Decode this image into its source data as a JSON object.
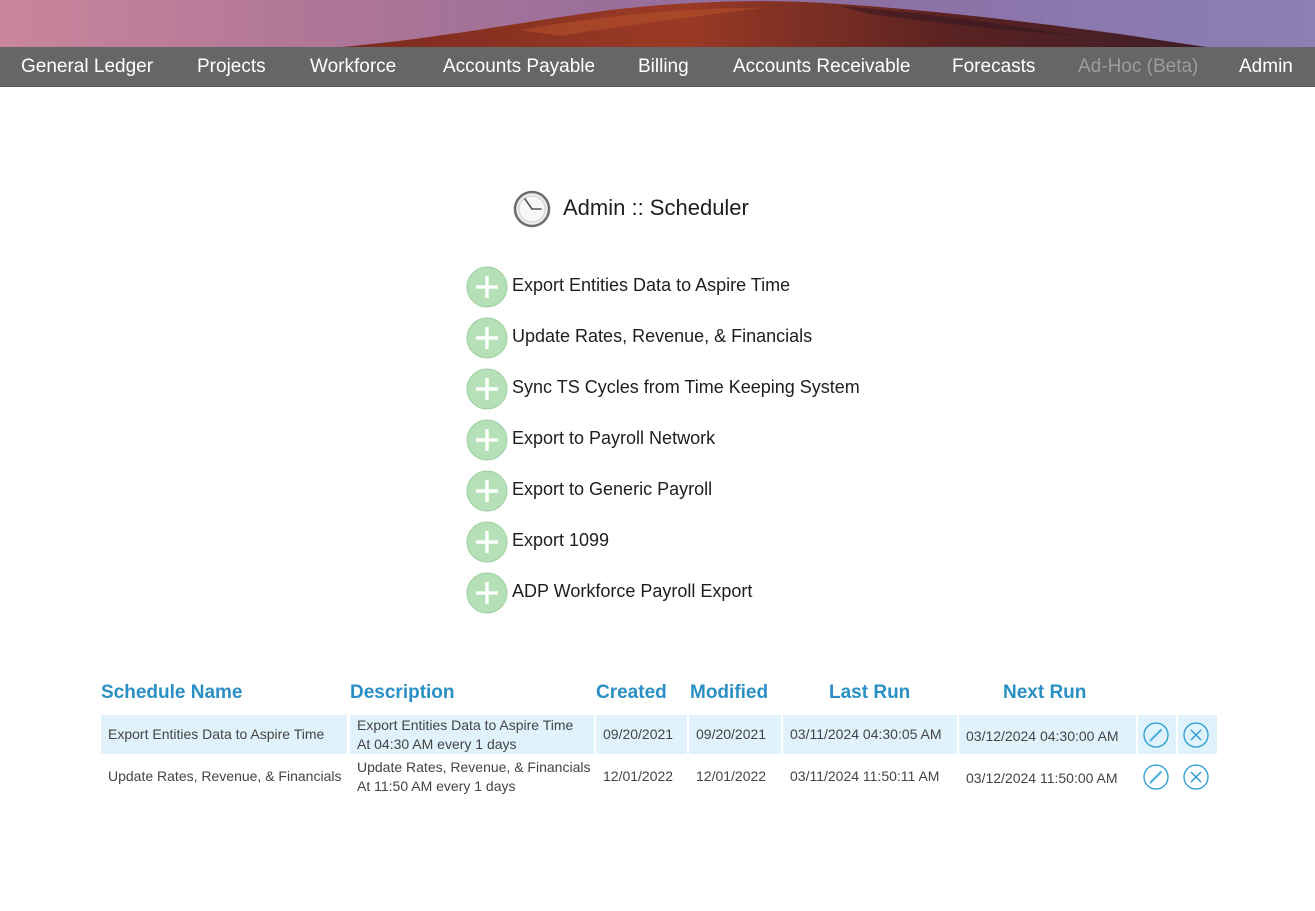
{
  "nav": {
    "items": [
      {
        "label": "General Ledger"
      },
      {
        "label": "Projects"
      },
      {
        "label": "Workforce"
      },
      {
        "label": "Accounts Payable"
      },
      {
        "label": "Billing"
      },
      {
        "label": "Accounts Receivable"
      },
      {
        "label": "Forecasts"
      },
      {
        "label": "Ad-Hoc (Beta)",
        "disabled": true
      },
      {
        "label": "Admin"
      }
    ]
  },
  "page": {
    "title": "Admin :: Scheduler",
    "title_icon": "clock-icon"
  },
  "tasks": [
    {
      "label": "Export Entities Data to Aspire Time",
      "icon": "add-icon"
    },
    {
      "label": "Update Rates, Revenue, & Financials",
      "icon": "add-icon"
    },
    {
      "label": "Sync TS Cycles from Time Keeping System",
      "icon": "add-icon"
    },
    {
      "label": "Export to Payroll Network",
      "icon": "add-icon"
    },
    {
      "label": "Export to Generic Payroll",
      "icon": "add-icon"
    },
    {
      "label": "Export 1099",
      "icon": "add-icon"
    },
    {
      "label": "ADP Workforce Payroll Export",
      "icon": "add-icon"
    }
  ],
  "table": {
    "headers": {
      "name": "Schedule Name",
      "description": "Description",
      "created": "Created",
      "modified": "Modified",
      "last_run": "Last Run",
      "next_run": "Next Run"
    },
    "rows": [
      {
        "name": "Export Entities Data to Aspire Time",
        "description": "Export Entities Data to Aspire Time",
        "schedule": "At 04:30 AM every 1 days",
        "created": "09/20/2021",
        "modified": "09/20/2021",
        "last_run": "03/11/2024 04:30:05 AM",
        "next_run": "03/12/2024 04:30:00 AM"
      },
      {
        "name": "Update Rates, Revenue, & Financials",
        "description": "Update Rates, Revenue, & Financials",
        "schedule": "At 11:50 AM every 1 days",
        "created": "12/01/2022",
        "modified": "12/01/2022",
        "last_run": "03/11/2024 11:50:11 AM",
        "next_run": "03/12/2024 11:50:00 AM"
      }
    ],
    "row_icons": [
      "edit-icon",
      "delete-icon"
    ]
  },
  "colors": {
    "nav_bg": "#666666",
    "header_text": "#2a8fc4",
    "row_shade": "#e0f3fc",
    "add_button": "#b6e0b8",
    "action_icon": "#2a9bd0"
  }
}
